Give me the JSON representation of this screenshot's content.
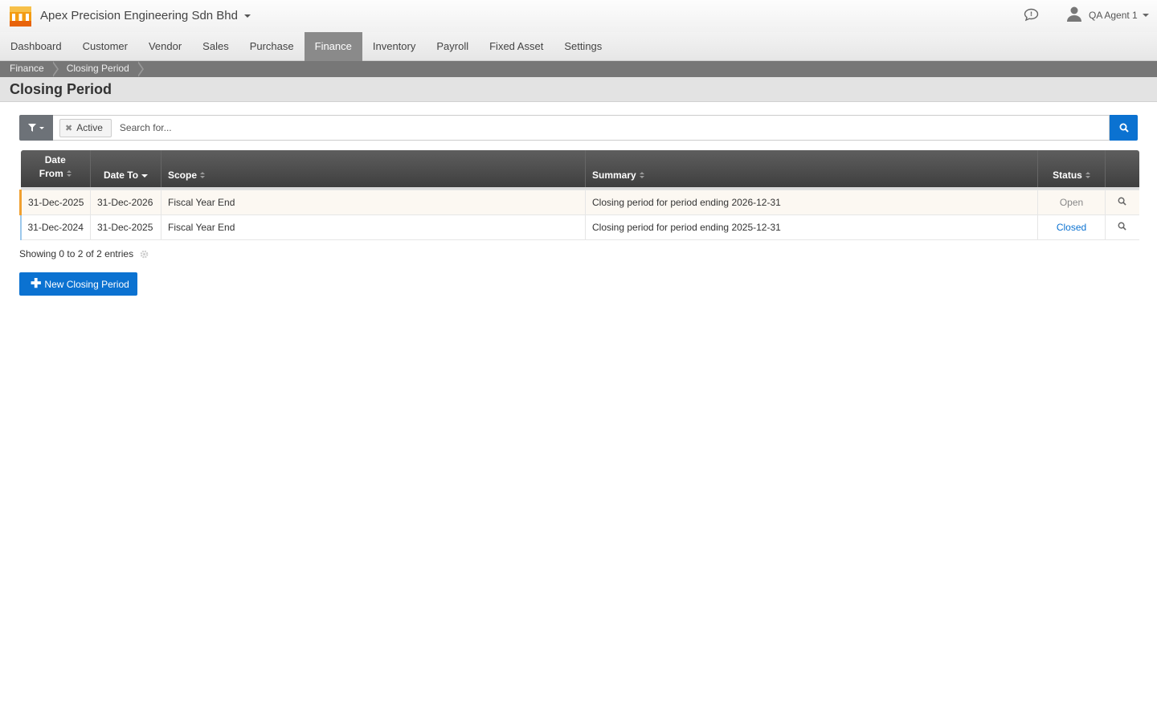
{
  "header": {
    "company_name": "Apex Precision Engineering Sdn Bhd",
    "user_name": "QA Agent 1"
  },
  "nav": {
    "items": [
      {
        "label": "Dashboard"
      },
      {
        "label": "Customer"
      },
      {
        "label": "Vendor"
      },
      {
        "label": "Sales"
      },
      {
        "label": "Purchase"
      },
      {
        "label": "Finance"
      },
      {
        "label": "Inventory"
      },
      {
        "label": "Payroll"
      },
      {
        "label": "Fixed Asset"
      },
      {
        "label": "Settings"
      }
    ],
    "active": "Finance"
  },
  "breadcrumb": {
    "items": [
      "Finance",
      "Closing Period"
    ]
  },
  "page": {
    "title": "Closing Period"
  },
  "search": {
    "filter_chip": "Active",
    "placeholder": "Search for..."
  },
  "table": {
    "columns": [
      "Date From",
      "Date To",
      "Scope",
      "Summary",
      "Status"
    ],
    "column_date_from_line1": "Date",
    "column_date_from_line2": "From",
    "rows": [
      {
        "date_from": "31-Dec-2025",
        "date_to": "31-Dec-2026",
        "scope": "Fiscal Year End",
        "summary": "Closing period for period ending 2026-12-31",
        "status": "Open"
      },
      {
        "date_from": "31-Dec-2024",
        "date_to": "31-Dec-2025",
        "scope": "Fiscal Year End",
        "summary": "Closing period for period ending 2025-12-31",
        "status": "Closed"
      }
    ]
  },
  "footer": {
    "info": "Showing 0 to 2 of 2 entries",
    "new_button_label": "New Closing Period"
  },
  "colors": {
    "primary": "#0b72d1",
    "open_row_marker": "#f0a030",
    "closed_row_marker": "#9cc8ec"
  }
}
